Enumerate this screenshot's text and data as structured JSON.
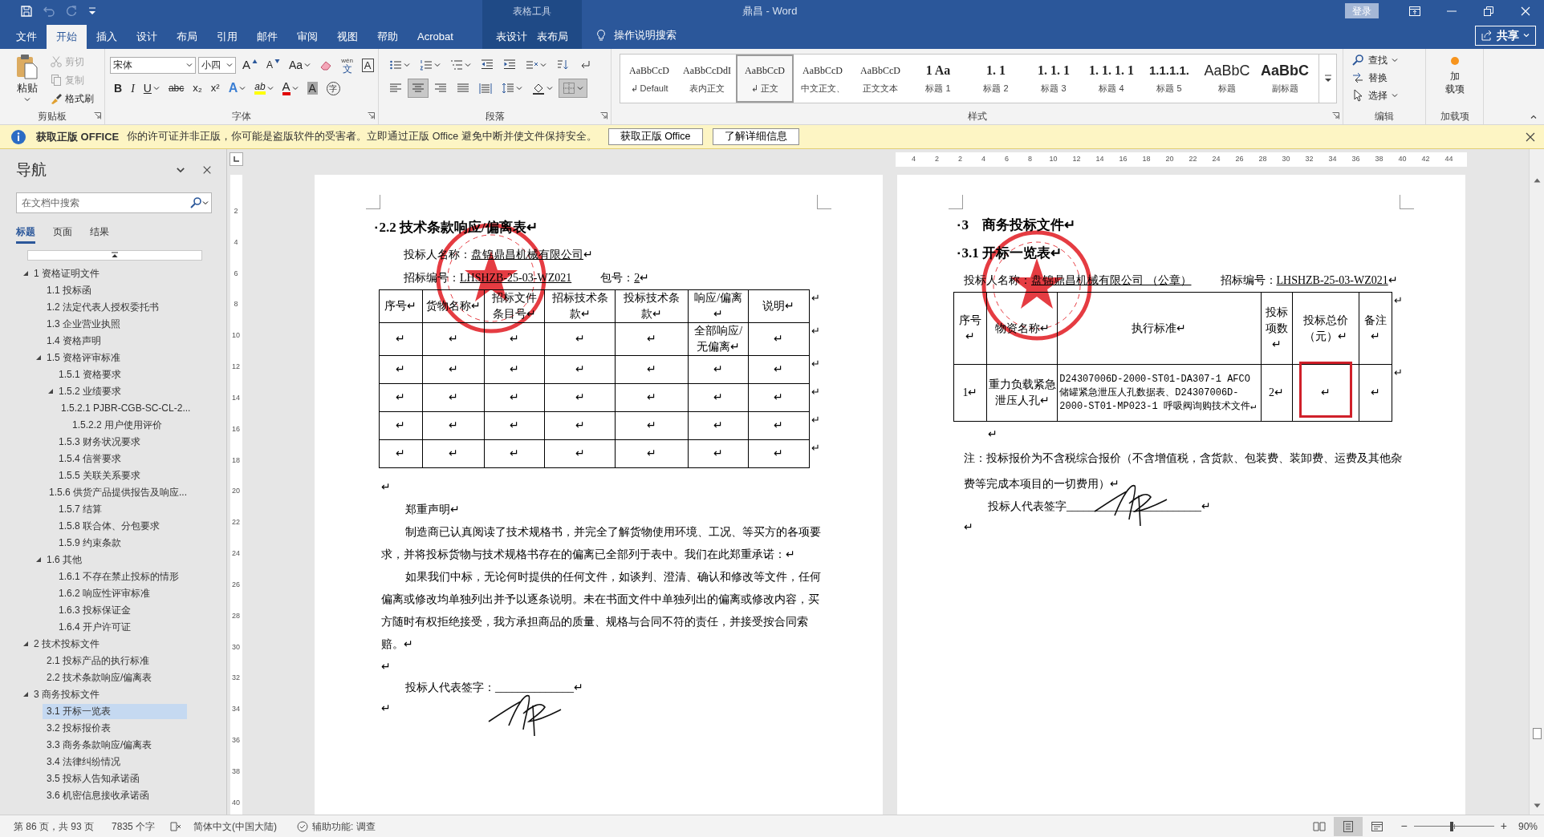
{
  "title_bar": {
    "context_label": "表格工具",
    "title": "鼎昌 - Word",
    "sign_in": "登录"
  },
  "quick_access": [
    {
      "kind": "save",
      "disabled": false
    },
    {
      "kind": "undo",
      "disabled": true
    },
    {
      "kind": "redo",
      "disabled": true
    },
    {
      "kind": "customize",
      "disabled": false
    }
  ],
  "tabs": [
    {
      "label": "文件",
      "kind": "file",
      "selected": false
    },
    {
      "label": "开始",
      "kind": "normal",
      "selected": true
    },
    {
      "label": "插入",
      "kind": "normal",
      "selected": false
    },
    {
      "label": "设计",
      "kind": "normal",
      "selected": false
    },
    {
      "label": "布局",
      "kind": "normal",
      "selected": false
    },
    {
      "label": "引用",
      "kind": "normal",
      "selected": false
    },
    {
      "label": "邮件",
      "kind": "normal",
      "selected": false
    },
    {
      "label": "审阅",
      "kind": "normal",
      "selected": false
    },
    {
      "label": "视图",
      "kind": "normal",
      "selected": false
    },
    {
      "label": "帮助",
      "kind": "normal",
      "selected": false
    },
    {
      "label": "Acrobat",
      "kind": "normal",
      "selected": false
    },
    {
      "label": "表设计",
      "kind": "contextual",
      "selected": false
    },
    {
      "label": "表布局",
      "kind": "contextual",
      "selected": false
    }
  ],
  "tell_me": "操作说明搜索",
  "share": "共享",
  "ribbon": {
    "clipboard": {
      "paste": "粘贴",
      "items": [
        {
          "kind": "cut",
          "label": "剪切",
          "disabled": true
        },
        {
          "kind": "copy",
          "label": "复制",
          "disabled": true
        },
        {
          "kind": "painter",
          "label": "格式刷",
          "disabled": false
        }
      ],
      "group": "剪贴板"
    },
    "font": {
      "name": "宋体",
      "size": "小四",
      "group": "字体",
      "row1": [
        {
          "kind": "grow",
          "label": "A"
        },
        {
          "kind": "shrink",
          "label": "A"
        },
        {
          "kind": "case",
          "label": "Aa",
          "menu": true
        },
        {
          "kind": "clear"
        },
        {
          "kind": "pinyin",
          "label": "文",
          "sub": "wén"
        },
        {
          "kind": "boxed",
          "label": "A"
        }
      ],
      "row2": [
        {
          "kind": "bold",
          "label": "B"
        },
        {
          "kind": "italic",
          "label": "I"
        },
        {
          "kind": "underline",
          "label": "U",
          "menu": true
        },
        {
          "kind": "strike",
          "label": "abc"
        },
        {
          "kind": "subscript",
          "label": "x₂"
        },
        {
          "kind": "superscript",
          "label": "x²"
        },
        {
          "kind": "effects",
          "label": "A",
          "menu": true
        },
        {
          "kind": "highlight",
          "label": "ab",
          "menu": true
        },
        {
          "kind": "color",
          "label": "A",
          "menu": true
        },
        {
          "kind": "shade",
          "label": "A"
        },
        {
          "kind": "enclose",
          "label": "字"
        }
      ]
    },
    "paragraph": {
      "group": "段落",
      "row1": [
        {
          "kind": "bullets",
          "menu": true
        },
        {
          "kind": "numbering",
          "menu": true
        },
        {
          "kind": "multilevel",
          "menu": true
        },
        {
          "kind": "outdent"
        },
        {
          "kind": "indent"
        },
        {
          "kind": "asian",
          "menu": true
        },
        {
          "kind": "sort"
        },
        {
          "kind": "marks"
        }
      ],
      "row2": [
        {
          "kind": "align_left",
          "selected": false
        },
        {
          "kind": "align_center",
          "selected": true
        },
        {
          "kind": "align_right",
          "selected": false
        },
        {
          "kind": "justify",
          "selected": false
        },
        {
          "kind": "distribute",
          "selected": false
        },
        {
          "kind": "line_spacing",
          "menu": true,
          "selected": false
        },
        {
          "kind": "shading",
          "menu": true,
          "selected": false
        },
        {
          "kind": "borders",
          "menu": true,
          "selected": true
        }
      ]
    },
    "styles": {
      "group": "样式",
      "items": [
        {
          "preview": "AaBbCcD",
          "name": "↲ Default",
          "kind": "body",
          "selected": false
        },
        {
          "preview": "AaBbCcDdI",
          "name": "表内正文",
          "kind": "body",
          "selected": false
        },
        {
          "preview": "AaBbCcD",
          "name": "↲ 正文",
          "kind": "body",
          "selected": true
        },
        {
          "preview": "AaBbCcD",
          "name": "中文正文、",
          "kind": "body",
          "selected": false
        },
        {
          "preview": "AaBbCcD",
          "name": "正文文本",
          "kind": "body",
          "selected": false
        },
        {
          "preview": "1 Aa",
          "name": "标题 1",
          "kind": "heading",
          "selected": false
        },
        {
          "preview": "1. 1",
          "name": "标题 2",
          "kind": "heading",
          "selected": false
        },
        {
          "preview": "1. 1. 1",
          "name": "标题 3",
          "kind": "heading",
          "selected": false
        },
        {
          "preview": "1. 1. 1. 1",
          "name": "标题 4",
          "kind": "heading",
          "selected": false
        },
        {
          "preview": "1.1.1.1.",
          "name": "标题 5",
          "kind": "strong",
          "selected": false
        },
        {
          "preview": "AaBbC",
          "name": "标题",
          "kind": "title",
          "selected": false
        },
        {
          "preview": "AaBbC",
          "name": "副标题",
          "kind": "subtitle",
          "selected": false
        }
      ]
    },
    "editing": {
      "group": "编辑",
      "items": [
        {
          "kind": "find",
          "label": "查找",
          "menu": true
        },
        {
          "kind": "replace",
          "label": "替换"
        },
        {
          "kind": "select",
          "label": "选择",
          "menu": true
        }
      ]
    },
    "addins": {
      "lines": [
        "加",
        "载项"
      ],
      "group": "加载项"
    }
  },
  "message_bar": {
    "title": "获取正版 OFFICE",
    "text": "你的许可证并非正版，你可能是盗版软件的受害者。立即通过正版 Office 避免中断并使文件保持安全。",
    "buttons": [
      "获取正版 Office",
      "了解详细信息"
    ]
  },
  "navigation": {
    "title": "导航",
    "search_placeholder": "在文档中搜索",
    "tabs": [
      {
        "label": "标题",
        "selected": true
      },
      {
        "label": "页面",
        "selected": false
      },
      {
        "label": "结果",
        "selected": false
      }
    ],
    "tree": [
      {
        "label": "1 资格证明文件",
        "expanded": true,
        "selected": false,
        "children": [
          {
            "label": "1.1 投标函",
            "selected": false
          },
          {
            "label": "1.2 法定代表人授权委托书",
            "selected": false
          },
          {
            "label": "1.3 企业营业执照",
            "selected": false
          },
          {
            "label": "1.4 资格声明",
            "selected": false
          },
          {
            "label": "1.5 资格评审标准",
            "expanded": true,
            "selected": false,
            "children": [
              {
                "label": "1.5.1 资格要求",
                "selected": false
              },
              {
                "label": "1.5.2 业绩要求",
                "expanded": true,
                "selected": false,
                "children": [
                  {
                    "label": "1.5.2.1 PJBR-CGB-SC-CL-2...",
                    "selected": false
                  },
                  {
                    "label": "1.5.2.2 用户使用评价",
                    "selected": false
                  }
                ]
              },
              {
                "label": "1.5.3 财务状况要求",
                "selected": false
              },
              {
                "label": "1.5.4 信誉要求",
                "selected": false
              },
              {
                "label": "1.5.5 关联关系要求",
                "selected": false
              },
              {
                "label": "1.5.6 供货产品提供报告及响应...",
                "selected": false
              },
              {
                "label": "1.5.7 结算",
                "selected": false
              },
              {
                "label": "1.5.8 联合体、分包要求",
                "selected": false
              },
              {
                "label": "1.5.9 约束条款",
                "selected": false
              }
            ]
          },
          {
            "label": "1.6 其他",
            "expanded": true,
            "selected": false,
            "children": [
              {
                "label": "1.6.1 不存在禁止投标的情形",
                "selected": false
              },
              {
                "label": "1.6.2 响应性评审标准",
                "selected": false
              },
              {
                "label": "1.6.3 投标保证金",
                "selected": false
              },
              {
                "label": "1.6.4 开户许可证",
                "selected": false
              }
            ]
          }
        ]
      },
      {
        "label": "2 技术投标文件",
        "expanded": true,
        "selected": false,
        "children": [
          {
            "label": "2.1 投标产品的执行标准",
            "selected": false
          },
          {
            "label": "2.2 技术条款响应/偏离表",
            "selected": false
          }
        ]
      },
      {
        "label": "3 商务投标文件",
        "expanded": true,
        "selected": false,
        "children": [
          {
            "label": "3.1 开标一览表",
            "selected": true
          },
          {
            "label": "3.2 投标报价表",
            "selected": false
          },
          {
            "label": "3.3 商务条款响应/偏离表",
            "selected": false
          },
          {
            "label": "3.4 法律纠纷情况",
            "selected": false
          },
          {
            "label": "3.5 投标人告知承诺函",
            "selected": false
          },
          {
            "label": "3.6 机密信息接收承诺函",
            "selected": false
          }
        ]
      }
    ]
  },
  "rulers": {
    "horizontal": [
      "4",
      "2",
      "2",
      "4",
      "6",
      "8",
      "10",
      "12",
      "14",
      "16",
      "18",
      "20",
      "22",
      "24",
      "26",
      "28",
      "30",
      "32",
      "34",
      "36",
      "38",
      "40",
      "42",
      "44"
    ],
    "vertical": [
      "2",
      "4",
      "6",
      "8",
      "10",
      "12",
      "14",
      "16",
      "18",
      "20",
      "22",
      "24",
      "26",
      "28",
      "30",
      "32",
      "34",
      "36",
      "38",
      "40"
    ]
  },
  "pages": [
    {
      "stamped": true,
      "signed": true,
      "blocks": [
        {
          "kind": "heading2",
          "bullet": "▪",
          "text": "2.2 技术条款响应/偏离表↵"
        },
        {
          "kind": "segments",
          "indent": true,
          "fields": [
            {
              "segments": [
                {
                  "text": "投标人名称：",
                  "underline": false
                },
                {
                  "text": "盘锦鼎昌机械有限公司",
                  "underline": true
                },
                {
                  "text": "↵",
                  "underline": false
                }
              ]
            }
          ]
        },
        {
          "kind": "segments",
          "indent": true,
          "fields": [
            {
              "segments": [
                {
                  "text": "招标编号：",
                  "underline": false
                },
                {
                  "text": "LHSHZB-25-03-WZ021",
                  "underline": true
                }
              ]
            },
            {
              "segments": [
                {
                  "text": "包号：",
                  "underline": false
                },
                {
                  "text": "2",
                  "underline": true
                },
                {
                  "text": "↵",
                  "underline": false
                }
              ]
            }
          ]
        },
        {
          "kind": "deviation_table",
          "columns": [
            "序号↵",
            "货物名称↵",
            "招标文件条目号↵",
            "招标技术条款↵",
            "投标技术条款↵",
            "响应/偏离↵",
            "说明↵"
          ],
          "header_end_mark": "↵",
          "rows": [
            {
              "cells": [
                "↵",
                "↵",
                "↵",
                "↵",
                "↵",
                "全部响应/无偏离↵",
                "↵"
              ],
              "end_mark": "↵"
            },
            {
              "cells": [
                "↵",
                "↵",
                "↵",
                "↵",
                "↵",
                "↵",
                "↵"
              ],
              "end_mark": "↵"
            },
            {
              "cells": [
                "↵",
                "↵",
                "↵",
                "↵",
                "↵",
                "↵",
                "↵"
              ],
              "end_mark": "↵"
            },
            {
              "cells": [
                "↵",
                "↵",
                "↵",
                "↵",
                "↵",
                "↵",
                "↵"
              ],
              "end_mark": "↵"
            },
            {
              "cells": [
                "↵",
                "↵",
                "↵",
                "↵",
                "↵",
                "↵",
                "↵"
              ],
              "end_mark": "↵"
            }
          ]
        },
        {
          "kind": "mark",
          "indent": false,
          "text": "↵"
        },
        {
          "kind": "para",
          "indent": true,
          "text": "郑重声明↵"
        },
        {
          "kind": "para",
          "indent": true,
          "text": "制造商已认真阅读了技术规格书，并完全了解货物使用环境、工况、等买方的各项要求，并将投标货物与技术规格书存在的偏离已全部列于表中。我们在此郑重承诺：↵"
        },
        {
          "kind": "para",
          "indent": true,
          "text": "如果我们中标，无论何时提供的任何文件，如谈判、澄清、确认和修改等文件，任何偏离或修改均单独列出并予以逐条说明。未在书面文件中单独列出的偏离或修改内容，买方随时有权拒绝接受，我方承担商品的质量、规格与合同不符的责任，并接受按合同索赔。↵"
        },
        {
          "kind": "mark",
          "indent": false,
          "text": "↵"
        },
        {
          "kind": "sign",
          "indent": true,
          "text": "投标人代表签字：______________↵"
        },
        {
          "kind": "mark",
          "indent": false,
          "text": "↵"
        }
      ]
    },
    {
      "stamped": true,
      "signed": true,
      "blocks": [
        {
          "kind": "heading1",
          "bullet": "▪",
          "text": "3　商务投标文件↵"
        },
        {
          "kind": "heading2",
          "bullet": "▪",
          "text": "3.1 开标一览表↵"
        },
        {
          "kind": "segments",
          "indent": false,
          "fields": [
            {
              "segments": [
                {
                  "text": "投标人名称：",
                  "underline": false
                },
                {
                  "text": "盘锦鼎昌机械有限公司 （公章）",
                  "underline": true
                }
              ]
            },
            {
              "segments": [
                {
                  "text": "招标编号：",
                  "underline": false
                },
                {
                  "text": "LHSHZB-25-03-WZ021",
                  "underline": true
                },
                {
                  "text": "↵",
                  "underline": false
                }
              ]
            }
          ]
        },
        {
          "kind": "summary_table",
          "columns": [
            "序号↵",
            "物资名称↵",
            "执行标准↵",
            "投标项数↵",
            "投标总价（元）↵",
            "备注↵"
          ],
          "header_end_mark": "↵",
          "rows": [
            {
              "cells": [
                {
                  "text": "1↵",
                  "highlighted": false
                },
                {
                  "text": "重力负载紧急泄压人孔↵",
                  "highlighted": false
                },
                {
                  "text": "D24307006D-2000-ST01-DA307-1 AFCO 储罐紧急泄压人孔数据表、D24307006D-2000-ST01-MP023-1 呼吸阀询购技术文件↵",
                  "highlighted": false
                },
                {
                  "text": "2↵",
                  "highlighted": false
                },
                {
                  "text": "↵",
                  "highlighted": true
                },
                {
                  "text": "↵",
                  "highlighted": false
                }
              ],
              "end_mark": "↵"
            }
          ]
        },
        {
          "kind": "mark",
          "indent": true,
          "text": "↵"
        },
        {
          "kind": "note",
          "indent": false,
          "text": "注：投标报价为不含税综合报价（不含增值税，含货款、包装费、装卸费、运费及其他杂费等完成本项目的一切费用）↵"
        },
        {
          "kind": "sign",
          "indent": true,
          "text": "投标人代表签字________________________↵"
        },
        {
          "kind": "mark",
          "indent": false,
          "text": "↵"
        }
      ]
    }
  ],
  "status_bar": {
    "page": "第 86 页，共 93 页",
    "words": "7835 个字",
    "language": "简体中文(中国大陆)",
    "accessibility": "辅助功能: 调查",
    "views": [
      {
        "kind": "read",
        "selected": false
      },
      {
        "kind": "print",
        "selected": true
      },
      {
        "kind": "web",
        "selected": false
      }
    ],
    "zoom_out": "−",
    "zoom_in": "+",
    "zoom": {
      "level": 0.47
    },
    "zoom_label": "90%"
  }
}
